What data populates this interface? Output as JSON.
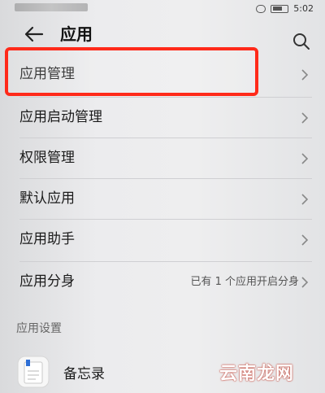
{
  "status_bar": {
    "time": "5:02"
  },
  "header": {
    "title": "应用"
  },
  "menu": {
    "items": [
      {
        "label": "应用管理"
      },
      {
        "label": "应用启动管理"
      },
      {
        "label": "权限管理"
      },
      {
        "label": "默认应用"
      },
      {
        "label": "应用助手"
      },
      {
        "label": "应用分身",
        "value": "已有 1 个应用开启分身"
      }
    ]
  },
  "section": {
    "title": "应用设置"
  },
  "apps": [
    {
      "label": "备忘录"
    }
  ],
  "watermark": {
    "text": "云南龙网"
  },
  "colors": {
    "highlight": "#ff2a1a",
    "background": "#e9eaec",
    "text": "#1b1b1b"
  }
}
